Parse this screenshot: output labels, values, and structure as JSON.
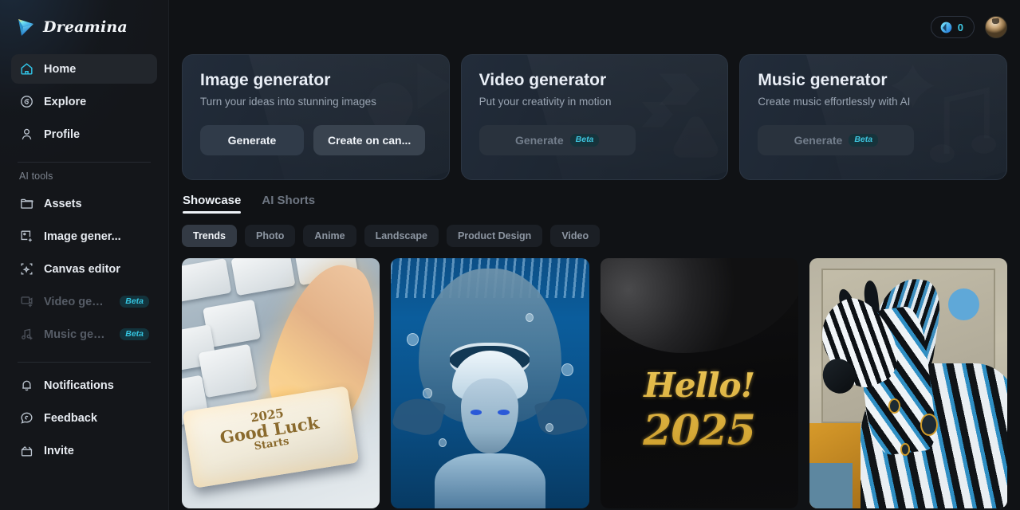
{
  "brand": {
    "name": "Dreamina",
    "logo_icon": "dreamina-arrow-logo"
  },
  "header": {
    "credits": {
      "value": "0",
      "icon": "gem-icon"
    },
    "avatar": {
      "icon": "user-avatar"
    }
  },
  "sidebar": {
    "primary": [
      {
        "label": "Home",
        "icon": "home-icon",
        "active": true
      },
      {
        "label": "Explore",
        "icon": "compass-icon",
        "active": false
      },
      {
        "label": "Profile",
        "icon": "person-icon",
        "active": false
      }
    ],
    "section_label": "AI tools",
    "tools": [
      {
        "label": "Assets",
        "icon": "folder-icon",
        "disabled": false,
        "badge": ""
      },
      {
        "label": "Image gener...",
        "icon": "image-add-icon",
        "disabled": false,
        "badge": ""
      },
      {
        "label": "Canvas editor",
        "icon": "canvas-icon",
        "disabled": false,
        "badge": ""
      },
      {
        "label": "Video gener...",
        "icon": "video-add-icon",
        "disabled": true,
        "badge": "Beta"
      },
      {
        "label": "Music gener...",
        "icon": "music-add-icon",
        "disabled": true,
        "badge": "Beta"
      }
    ],
    "footer": [
      {
        "label": "Notifications",
        "icon": "bell-icon"
      },
      {
        "label": "Feedback",
        "icon": "chat-icon"
      },
      {
        "label": "Invite",
        "icon": "invite-icon"
      }
    ]
  },
  "cards": [
    {
      "title": "Image generator",
      "subtitle": "Turn your ideas into stunning images",
      "primary_action": "Generate",
      "secondary_action": "Create on can...",
      "disabled": false,
      "badge": ""
    },
    {
      "title": "Video generator",
      "subtitle": "Put your creativity in motion",
      "primary_action": "Generate",
      "secondary_action": "",
      "disabled": true,
      "badge": "Beta"
    },
    {
      "title": "Music generator",
      "subtitle": "Create music effortlessly with AI",
      "primary_action": "Generate",
      "secondary_action": "",
      "disabled": true,
      "badge": "Beta"
    }
  ],
  "tabs": [
    {
      "label": "Showcase",
      "active": true
    },
    {
      "label": "AI Shorts",
      "active": false
    }
  ],
  "chips": [
    {
      "label": "Trends",
      "active": true
    },
    {
      "label": "Photo",
      "active": false
    },
    {
      "label": "Anime",
      "active": false
    },
    {
      "label": "Landscape",
      "active": false
    },
    {
      "label": "Product Design",
      "active": false
    },
    {
      "label": "Video",
      "active": false
    }
  ],
  "gallery": [
    {
      "name": "keyboard-good-luck-2025",
      "text_line1": "2025",
      "text_line2": "Good Luck",
      "text_line3": "Starts"
    },
    {
      "name": "underwater-shark-warrior",
      "text_line1": "",
      "text_line2": "",
      "text_line3": ""
    },
    {
      "name": "hello-2025-gold-lettering",
      "text_line1": "Hello!",
      "text_line2": "2025",
      "text_line3": ""
    },
    {
      "name": "mechanical-zebra-painting",
      "text_line1": "",
      "text_line2": "",
      "text_line3": ""
    }
  ],
  "colors": {
    "accent_cyan": "#31c5e8",
    "background": "#101215",
    "sidebar": "#14161a",
    "card_gradient_start": "#222c3a",
    "beta_text": "#35c4df"
  }
}
